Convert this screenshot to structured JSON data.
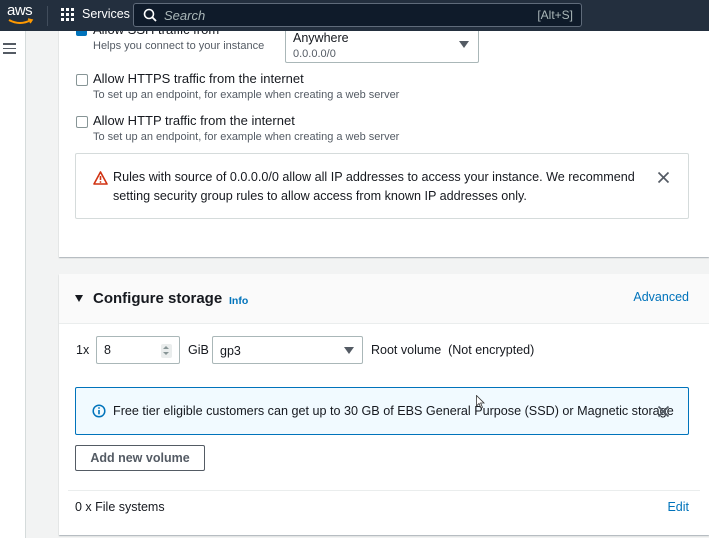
{
  "topnav": {
    "logo_text": "aws",
    "services_label": "Services",
    "search_placeholder": "Search",
    "search_shortcut": "[Alt+S]"
  },
  "network": {
    "ssh": {
      "label": "Allow SSH traffic from",
      "checked": true,
      "description": "Helps you connect to your instance",
      "source_value": "Anywhere",
      "source_sub": "0.0.0.0/0"
    },
    "https": {
      "label": "Allow HTTPS traffic from the internet",
      "checked": false,
      "description": "To set up an endpoint, for example when creating a web server"
    },
    "http": {
      "label": "Allow HTTP traffic from the internet",
      "checked": false,
      "description": "To set up an endpoint, for example when creating a web server"
    },
    "warning": {
      "message": "Rules with source of 0.0.0.0/0 allow all IP addresses to access your instance. We recommend setting security group rules to allow access from known IP addresses only."
    }
  },
  "storage": {
    "title": "Configure storage",
    "info_label": "Info",
    "advanced_label": "Advanced",
    "volume": {
      "count": "1x",
      "size": "8",
      "unit": "GiB",
      "type": "gp3",
      "description": "Root volume  (Not encrypted)"
    },
    "info_alert": {
      "message": "Free tier eligible customers can get up to 30 GB of EBS General Purpose (SSD) or Magnetic storage"
    },
    "add_volume_label": "Add new volume",
    "file_systems_label": "0 x File systems",
    "edit_label": "Edit"
  },
  "colors": {
    "nav_bg": "#232f3e",
    "link": "#0073bb",
    "warning_icon": "#d13212",
    "info_bg": "#f1faff",
    "page_bg": "#f2f3f3"
  }
}
